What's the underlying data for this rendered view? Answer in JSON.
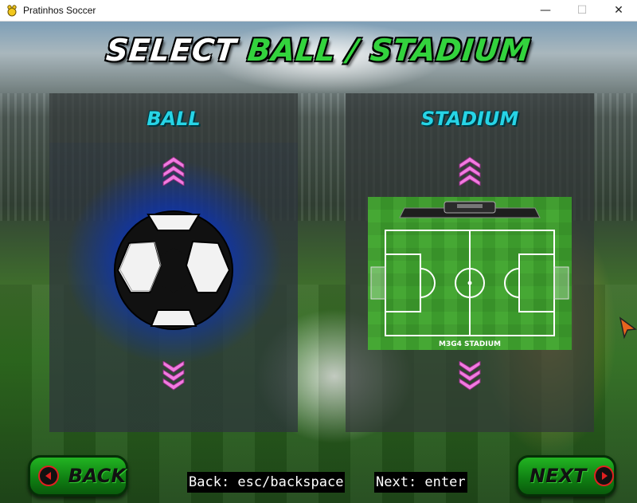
{
  "window": {
    "title": "Pratinhos Soccer",
    "controls": [
      "—",
      "☐",
      "✕"
    ]
  },
  "screen": {
    "title_part1": "SELECT",
    "title_part2": "BALL / STADIUM"
  },
  "ball_panel": {
    "title": "BALL",
    "up_icon": "chevron-up-icon",
    "down_icon": "chevron-down-icon"
  },
  "stadium_panel": {
    "title": "STADIUM",
    "stadium_name": "M3G4 STADIUM"
  },
  "buttons": {
    "back": "BACK",
    "next": "NEXT"
  },
  "hints": {
    "back": "Back: esc/backspace",
    "next": "Next: enter"
  },
  "colors": {
    "accent_green": "#33d33d",
    "panel_title": "#27d4e6",
    "arrow_pink": "#f27ae0",
    "button_green": "#169a18"
  }
}
